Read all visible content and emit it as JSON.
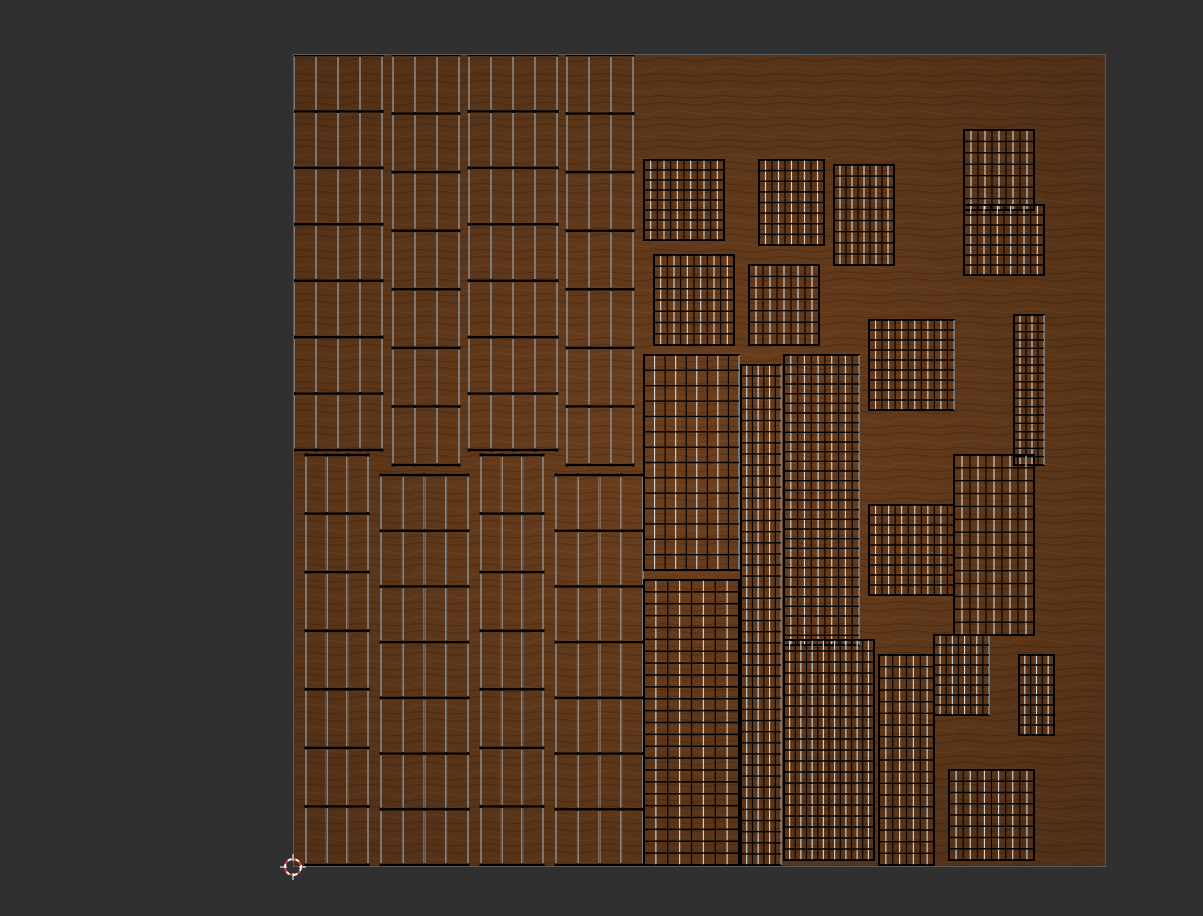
{
  "editor": {
    "type": "UV Editor"
  },
  "texture": {
    "name": "wood",
    "base_color": "#6b3f1d",
    "dark_color": "#4a2a12",
    "light_color": "#8a5327"
  },
  "uv_overlay": {
    "edge_color": "#000000",
    "highlight_color": "#d9d9d9"
  },
  "cursor": {
    "icon": "2d-cursor-icon",
    "colors": [
      "#ffffff",
      "#e04040"
    ]
  }
}
